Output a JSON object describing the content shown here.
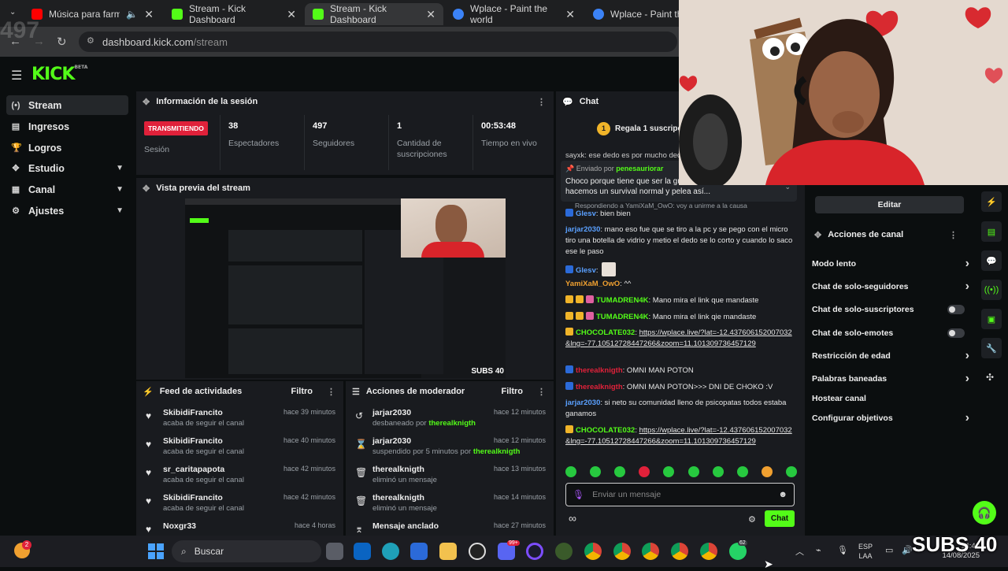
{
  "browser": {
    "tabs": [
      {
        "title": "Música para farmear tr",
        "active": false
      },
      {
        "title": "Stream - Kick Dashboard",
        "active": false
      },
      {
        "title": "Stream - Kick Dashboard",
        "active": true
      },
      {
        "title": "Wplace - Paint the world",
        "active": false
      },
      {
        "title": "Wplace - Paint the w",
        "active": false
      }
    ],
    "url_main": "dashboard.kick.com",
    "url_path": "/stream",
    "overlay_number": "497"
  },
  "logo": {
    "text": "KICK",
    "tag": "BETA"
  },
  "sidebar": {
    "items": [
      {
        "label": "Stream"
      },
      {
        "label": "Ingresos"
      },
      {
        "label": "Logros"
      },
      {
        "label": "Estudio"
      },
      {
        "label": "Canal"
      },
      {
        "label": "Ajustes"
      }
    ]
  },
  "session": {
    "title": "Información de la sesión",
    "badge": "TRANSMITIENDO",
    "badge_label": "Sesión",
    "stats": [
      {
        "value": "38",
        "label": "Espectadores"
      },
      {
        "value": "497",
        "label": "Seguidores"
      },
      {
        "value": "1",
        "label": "Cantidad de suscripciones"
      },
      {
        "value": "00:53:48",
        "label": "Tiempo en vivo"
      }
    ]
  },
  "preview": {
    "title": "Vista previa del stream",
    "subs": "SUBS 40"
  },
  "activity": {
    "title": "Feed de actividades",
    "filter": "Filtro",
    "items": [
      {
        "name": "SkibidiFrancito",
        "action": "acaba de seguir el canal",
        "time": "hace 39 minutos"
      },
      {
        "name": "SkibidiFrancito",
        "action": "acaba de seguir el canal",
        "time": "hace 40 minutos"
      },
      {
        "name": "sr_caritapapota",
        "action": "acaba de seguir el canal",
        "time": "hace 42 minutos"
      },
      {
        "name": "SkibidiFrancito",
        "action": "acaba de seguir el canal",
        "time": "hace 42 minutos"
      },
      {
        "name": "Noxgr33",
        "action": "",
        "time": "hace 4 horas"
      }
    ]
  },
  "modactions": {
    "title": "Acciones de moderador",
    "filter": "Filtro",
    "items": [
      {
        "name": "jarjar2030",
        "action": "desbaneado por",
        "by": "therealknigth",
        "time": "hace 12 minutos"
      },
      {
        "name": "jarjar2030",
        "action": "suspendido por 5 minutos por",
        "by": "therealknigth",
        "time": "hace 12 minutos"
      },
      {
        "name": "therealknigth",
        "action": "eliminó un mensaje",
        "by": "",
        "time": "hace 13 minutos"
      },
      {
        "name": "therealknigth",
        "action": "eliminó un mensaje",
        "by": "",
        "time": "hace 14 minutos"
      },
      {
        "name": "Mensaje anclado",
        "action": "",
        "by": "",
        "time": "hace 27 minutos"
      }
    ]
  },
  "chat": {
    "title": "Chat",
    "gift_banner": "Regala 1 suscripción",
    "pinned_partial": "sayxk: ese dedo es por mucho ded",
    "pinned_by_label": "Enviado por",
    "pinned_by_user": "penesauriorar",
    "pinned_text": "Choco porque tiene que ser la guerra de las... ...porque no solo hacemos un survival normal y pelea así...",
    "reply_to": "Respondiendo a YamiXaM_OwO: voy a unirme a la causa",
    "messages": [
      {
        "user": "Glesv",
        "text": ": bien bien"
      },
      {
        "user": "jarjar2030",
        "text": ": mano eso fue que se tiro a la pc y se pego con el micro tiro una botella de vidrio y metio el dedo se lo corto y cuando lo saco ese le paso"
      },
      {
        "user": "Glesv",
        "text": ":"
      },
      {
        "user": "YamiXaM_OwO",
        "text": ": ^^"
      },
      {
        "user": "TUMADREN4K",
        "text": ": Mano mira el link que mandaste"
      },
      {
        "user": "TUMADREN4K",
        "text": ": Mano mira el link qie mandaste"
      },
      {
        "user": "CHOCOLATE032",
        "text": ": ",
        "link": "https://wplace.live/?lat=-12.437606152007032&lng=-77.10512728447266&zoom=11.101309736457129"
      },
      {
        "user": "therealknigth",
        "text": ": OMNI MAN POTON"
      },
      {
        "user": "therealknigth",
        "text": ": OMNI MAN POTON>>> DNI DE CHOKO :V"
      },
      {
        "user": "jarjar2030",
        "text": ": si neto su comunidad lleno de psicopatas todos estaba ganamos"
      },
      {
        "user": "CHOCOLATE032",
        "text": ": ",
        "link": "https://wplace.live/?lat=-12.437606152007032&lng=-77.10512728447266&zoom=11.101309736457129"
      }
    ],
    "input_placeholder": "Enviar un mensaje",
    "send_label": "Chat",
    "infinity": "∞"
  },
  "channel_actions": {
    "edit_label": "Editar",
    "title": "Acciones de canal",
    "items": [
      {
        "label": "Modo lento",
        "type": "chevron"
      },
      {
        "label": "Chat de solo-seguidores",
        "type": "chevron"
      },
      {
        "label": "Chat de solo-suscriptores",
        "type": "toggle"
      },
      {
        "label": "Chat de solo-emotes",
        "type": "toggle"
      },
      {
        "label": "Restricción de edad",
        "type": "chevron"
      },
      {
        "label": "Palabras baneadas",
        "type": "chevron"
      },
      {
        "label": "Hostear canal",
        "type": "none"
      },
      {
        "label": "Configurar objetivos",
        "type": "chevron"
      }
    ]
  },
  "taskbar": {
    "search": "Buscar",
    "lang": "ESP",
    "lang2": "LAA",
    "time": "14:40",
    "date": "14/08/2025",
    "notif_badge": "2",
    "badge_99": "99+",
    "badge_62": "62",
    "overlay": "SUBS 40"
  },
  "colors": {
    "kick_green": "#53fc18",
    "live_red": "#e0213a",
    "panel": "#191b1f",
    "bg": "#0b0e0f"
  }
}
